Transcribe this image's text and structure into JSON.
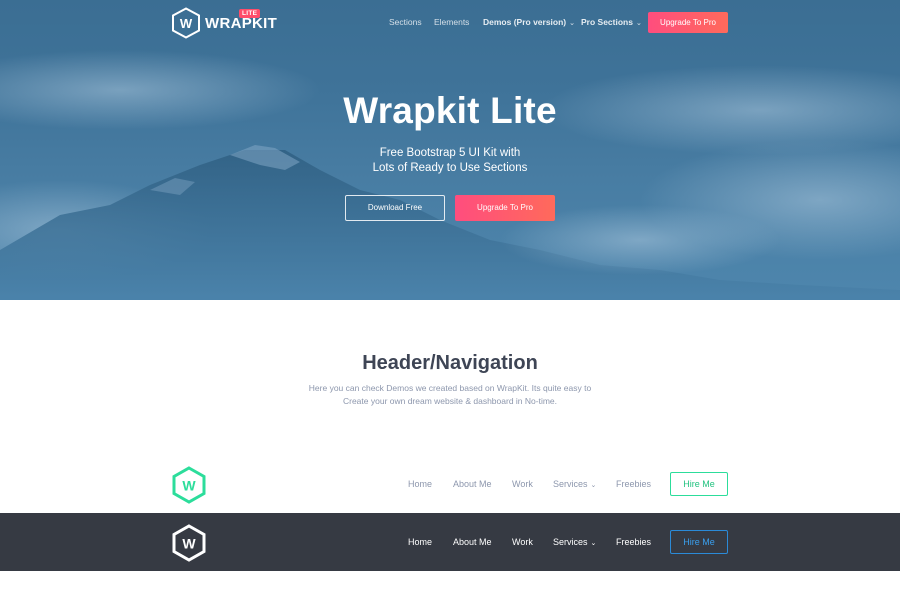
{
  "brand": {
    "name": "WRAPKIT",
    "badge": "LITE",
    "logo_letter": "W"
  },
  "topnav": {
    "links": [
      {
        "label": "Sections",
        "has_dropdown": false
      },
      {
        "label": "Elements",
        "has_dropdown": false
      },
      {
        "label": "Demos (Pro version)",
        "has_dropdown": true
      },
      {
        "label": "Pro Sections",
        "has_dropdown": true
      }
    ],
    "cta_label": "Upgrade To Pro"
  },
  "hero": {
    "title": "Wrapkit Lite",
    "subtitle_line1": "Free Bootstrap 5 UI Kit with",
    "subtitle_line2": "Lots of Ready to Use Sections",
    "download_label": "Download Free",
    "upgrade_label": "Upgrade To Pro"
  },
  "section": {
    "title": "Header/Navigation",
    "desc_line1": "Here you can check Demos we created based on WrapKit. Its quite easy to",
    "desc_line2": "Create your own dream website & dashboard in No-time."
  },
  "demo_nav_light": {
    "links": [
      "Home",
      "About Me",
      "Work",
      "Services",
      "Freebies"
    ],
    "cta_label": "Hire Me"
  },
  "demo_nav_dark": {
    "links": [
      "Home",
      "About Me",
      "Work",
      "Services",
      "Freebies"
    ],
    "cta_label": "Hire Me"
  },
  "icons": {
    "chevron": "chevron-down-icon",
    "logo": "hexagon-w-logo-icon"
  },
  "colors": {
    "accent_gradient_start": "#ff4d7e",
    "accent_gradient_end": "#ff6a5b",
    "teal": "#2cdd9b",
    "blue": "#2b8ad8",
    "dark_bar": "#363a43",
    "heading": "#3e4555",
    "muted": "#8d97ad"
  }
}
